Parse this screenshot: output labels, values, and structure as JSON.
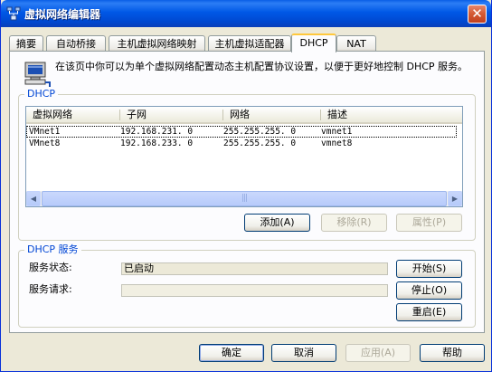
{
  "window": {
    "title": "虚拟网络编辑器",
    "close_glyph": "✕"
  },
  "tabs": [
    {
      "label": "摘要",
      "active": false
    },
    {
      "label": "自动桥接",
      "active": false
    },
    {
      "label": "主机虚拟网络映射",
      "active": false
    },
    {
      "label": "主机虚拟适配器",
      "active": false
    },
    {
      "label": "DHCP",
      "active": true
    },
    {
      "label": "NAT",
      "active": false
    }
  ],
  "intro": {
    "icon": "computer-network-icon",
    "text": "在该页中你可以为单个虚拟网络配置动态主机配置协议设置，以便于更好地控制 DHCP 服务。"
  },
  "dhcp_group": {
    "legend": "DHCP",
    "columns": [
      "虚拟网络",
      "子网",
      "网络",
      "描述"
    ],
    "rows": [
      {
        "network": "VMnet1",
        "subnet": "192.168.231.  0",
        "mask": "255.255.255.  0",
        "desc": "vmnet1",
        "selected": true
      },
      {
        "network": "VMnet8",
        "subnet": "192.168.233.  0",
        "mask": "255.255.255.  0",
        "desc": "vmnet8",
        "selected": false
      }
    ],
    "scroll_left_glyph": "◀",
    "scroll_right_glyph": "▶",
    "scroll_grip": "|||",
    "buttons": {
      "add": "添加(A)",
      "remove": "移除(R)",
      "properties": "属性(P)"
    }
  },
  "service_group": {
    "legend": "DHCP 服务",
    "status_label": "服务状态:",
    "status_value": "已启动",
    "request_label": "服务请求:",
    "request_value": "",
    "buttons": {
      "start": "开始(S)",
      "stop": "停止(O)",
      "restart": "重启(E)"
    }
  },
  "footer": {
    "ok": "确定",
    "cancel": "取消",
    "apply": "应用(A)",
    "help": "帮助"
  },
  "colors": {
    "titlebar": "#0058e6",
    "window_bg": "#ece9d8",
    "group_legend": "#0046d5",
    "active_tab_accent": "#ffc83c"
  }
}
